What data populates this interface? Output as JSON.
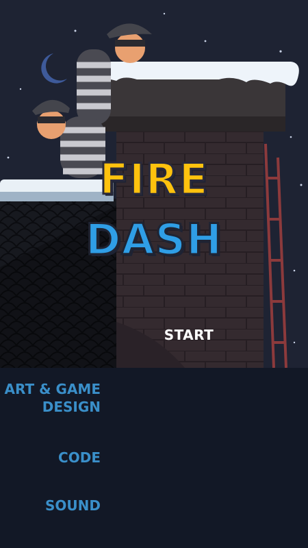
{
  "title": {
    "line1": "FIRE",
    "line2": "DASH"
  },
  "menu": {
    "start_label": "START"
  },
  "credits": {
    "art_line1": "ART & GAME",
    "art_line2": "DESIGN",
    "code": "CODE",
    "sound": "SOUND"
  },
  "colors": {
    "sky": "#1e2333",
    "title_fire": "#ffc20e",
    "title_dash": "#2f9ee6",
    "credit_text": "#3a8fc9",
    "credits_bg": "#121826"
  }
}
